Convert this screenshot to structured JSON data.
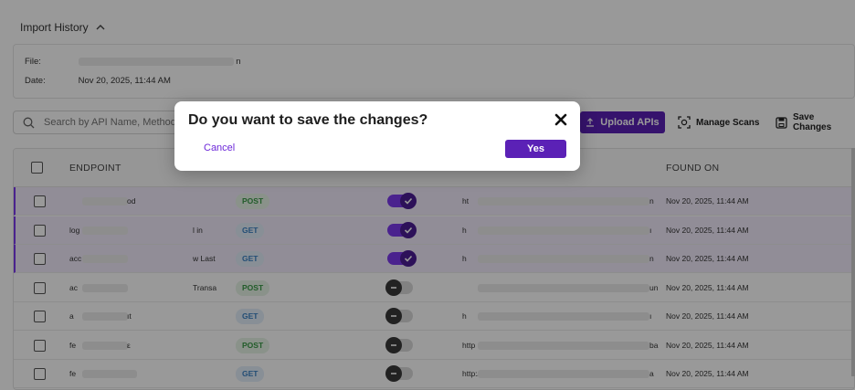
{
  "history": {
    "title": "Import History",
    "file_label": "File:",
    "file_value_suffix": "n",
    "date_label": "Date:",
    "date_value": "Nov 20, 2025, 11:44 AM"
  },
  "toolbar": {
    "search_placeholder": "Search by API Name, Method,",
    "upload_label": "Upload APIs",
    "manage_label": "Manage Scans",
    "save_label": "Save Changes"
  },
  "table": {
    "columns": [
      "ENDPOINT",
      "FOUND ON"
    ],
    "rows": [
      {
        "name_start": "",
        "name_end": "od",
        "method": "POST",
        "enabled": true,
        "url_start": "ht",
        "url_end": "n",
        "found_on": "Nov 20, 2025, 11:44 AM",
        "selected": true
      },
      {
        "name_start": "log",
        "name_end": "l in",
        "method": "GET",
        "enabled": true,
        "url_start": "h",
        "url_end": "ı",
        "found_on": "Nov 20, 2025, 11:44 AM",
        "selected": true
      },
      {
        "name_start": "acc",
        "name_end": "w Last",
        "method": "GET",
        "enabled": true,
        "url_start": "h",
        "url_end": "n",
        "found_on": "Nov 20, 2025, 11:44 AM",
        "selected": true
      },
      {
        "name_start": "ac",
        "name_end": "Transa",
        "method": "POST",
        "enabled": false,
        "url_start": "",
        "url_end": "un",
        "found_on": "Nov 20, 2025, 11:44 AM",
        "selected": false
      },
      {
        "name_start": "a",
        "name_end": "ıt",
        "method": "GET",
        "enabled": false,
        "url_start": "h",
        "url_end": "ı",
        "found_on": "Nov 20, 2025, 11:44 AM",
        "selected": false
      },
      {
        "name_start": "fe",
        "name_end": "ε",
        "method": "POST",
        "enabled": false,
        "url_start": "http",
        "url_end": "ba",
        "found_on": "Nov 20, 2025, 11:44 AM",
        "selected": false
      },
      {
        "name_start": "fe",
        "name_end": "",
        "method": "GET",
        "enabled": false,
        "url_start": "http:/",
        "url_end": "a",
        "found_on": "Nov 20, 2025, 11:44 AM",
        "selected": false
      }
    ]
  },
  "modal": {
    "title": "Do you want to save the changes?",
    "cancel_label": "Cancel",
    "confirm_label": "Yes"
  },
  "colors": {
    "accent": "#5b21b6",
    "selected_row": "#f2ecfc",
    "post_badge": "#3a9a47",
    "get_badge": "#3b82c4"
  },
  "icons": [
    "search-icon",
    "chevron-up-icon",
    "upload-icon",
    "scan-icon",
    "save-icon",
    "close-icon",
    "check-icon",
    "minus-icon"
  ]
}
